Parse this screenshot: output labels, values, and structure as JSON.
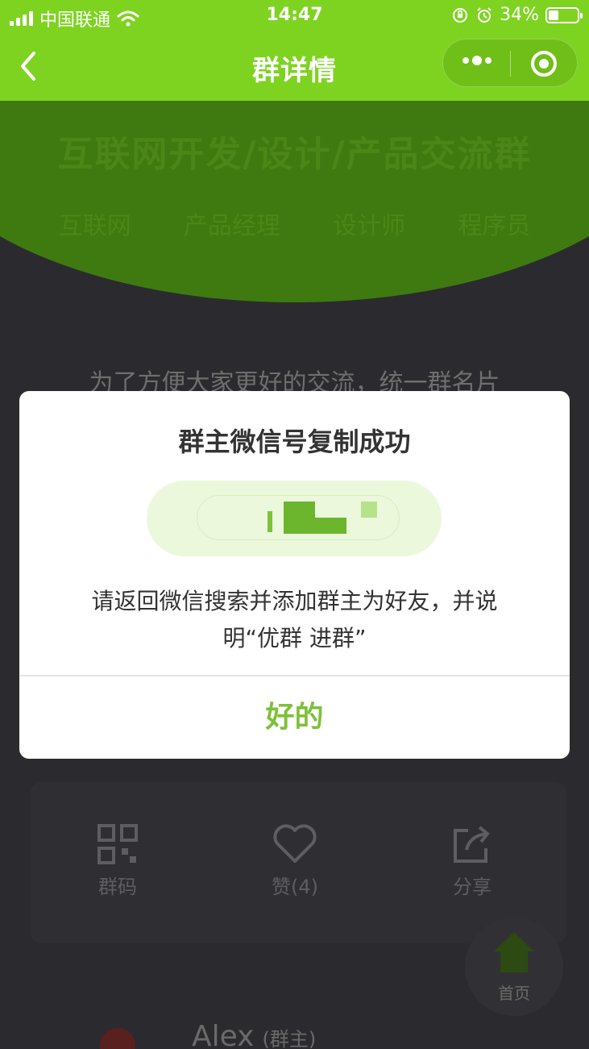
{
  "status_bar": {
    "carrier": "中国联通",
    "time": "14:47",
    "battery_text": "34%",
    "battery_level": 0.34,
    "icons": [
      "signal-icon",
      "wifi-icon",
      "rotation-lock-icon",
      "alarm-icon",
      "battery-icon"
    ]
  },
  "nav": {
    "title": "群详情",
    "back_icon": "chevron-left-icon",
    "more_icon": "more-dots-icon",
    "close_icon": "target-icon"
  },
  "background": {
    "group_title": "互联网开发/设计/产品交流群",
    "tags": [
      "互联网",
      "产品经理",
      "设计师",
      "程序员"
    ],
    "notice": "为了方便大家更好的交流，统一群名片",
    "actions": [
      {
        "label": "群码",
        "icon": "qr-code-icon"
      },
      {
        "label": "赞(4)",
        "icon": "heart-icon"
      },
      {
        "label": "分享",
        "icon": "share-icon"
      }
    ],
    "home_label": "首页",
    "member_name": "Alex",
    "member_role": "(群主)"
  },
  "modal": {
    "title": "群主微信号复制成功",
    "account": "",
    "message": "请返回微信搜索并添加群主为好友，并说明“优群 进群”",
    "ok_label": "好的"
  },
  "colors": {
    "brand_green": "#7ed321",
    "button_green": "#7ec03a",
    "pill_bg": "#ecf8dc"
  }
}
